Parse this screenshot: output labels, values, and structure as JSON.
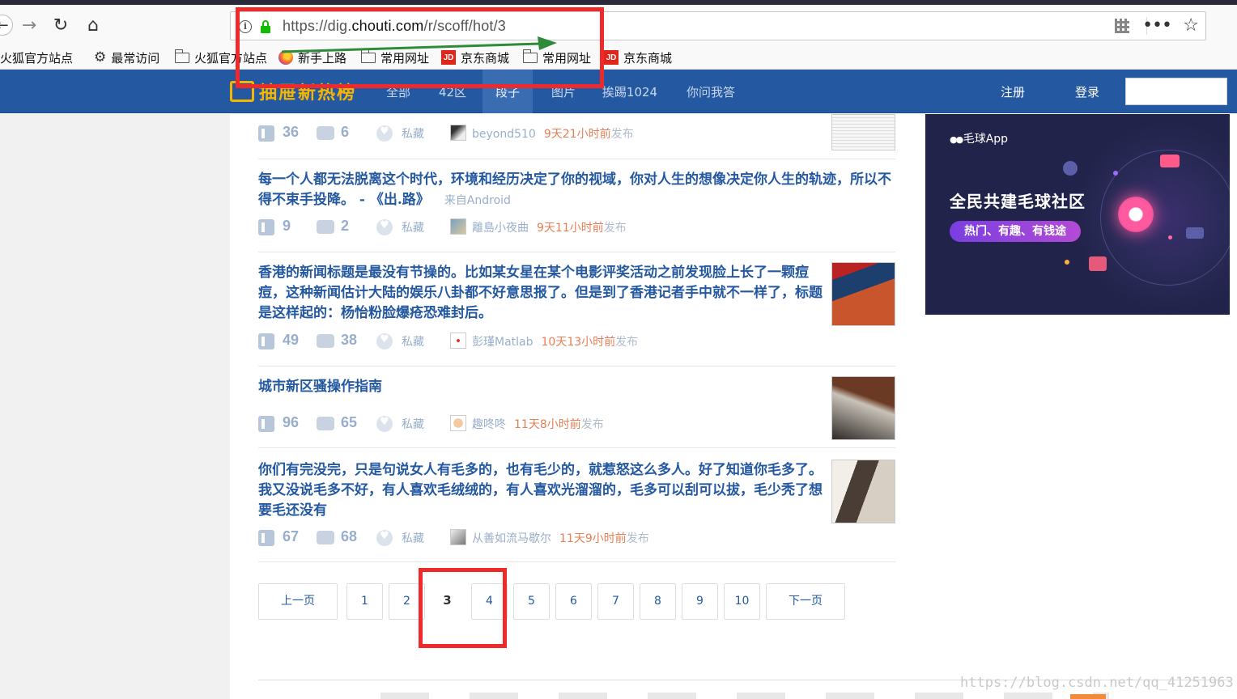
{
  "browser": {
    "url_prefix": "https://dig.",
    "url_domain": "chouti.com",
    "url_path": "/r/scoff/hot/3",
    "bookmarks": [
      "火狐官方站点",
      "最常访问",
      "火狐官方站点",
      "新手上路",
      "常用网址",
      "京东商城",
      "常用网址",
      "京东商城"
    ],
    "jd_badge": "JD"
  },
  "site": {
    "logo_text": "抽屉新热榜",
    "nav": [
      "全部",
      "42区",
      "段子",
      "图片",
      "挨踢1024",
      "你问我答"
    ],
    "active_nav": "段子",
    "register": "注册",
    "login": "登录"
  },
  "items": [
    {
      "title": "",
      "likes": "36",
      "comments": "6",
      "fav": "私藏",
      "user": "beyond510",
      "time": "9天21小时前",
      "pub": "发布"
    },
    {
      "title": "每一个人都无法脱离这个时代，环境和经历决定了你的视域，你对人生的想像决定你人生的轨迹，所以不得不束手投降。 - 《出.路》",
      "source": "来自Android",
      "likes": "9",
      "comments": "2",
      "fav": "私藏",
      "user": "離島小夜曲",
      "time": "9天11小时前",
      "pub": "发布"
    },
    {
      "title": "香港的新闻标题是最没有节操的。比如某女星在某个电影评奖活动之前发现脸上长了一颗痘痘，这种新闻估计大陆的娱乐八卦都不好意思报了。但是到了香港记者手中就不一样了，标题是这样起的：杨怡粉脸爆疮恐难封后。",
      "likes": "49",
      "comments": "38",
      "fav": "私藏",
      "user": "彭瑾Matlab",
      "time": "10天13小时前",
      "pub": "发布"
    },
    {
      "title": "城市新区骚操作指南",
      "likes": "96",
      "comments": "65",
      "fav": "私藏",
      "user": "趣咚咚",
      "time": "11天8小时前",
      "pub": "发布"
    },
    {
      "title": "你们有完没完，只是句说女人有毛多的，也有毛少的，就惹怒这么多人。好了知道你毛多了。我又没说毛多不好，有人喜欢毛绒绒的，有人喜欢光溜溜的，毛多可以刮可以拔，毛少秃了想要毛还没有",
      "likes": "67",
      "comments": "68",
      "fav": "私藏",
      "user": "从善如流马歇尔",
      "time": "11天9小时前",
      "pub": "发布"
    }
  ],
  "pager": {
    "prev": "上一页",
    "pages": [
      "1",
      "2",
      "3",
      "4",
      "5",
      "6",
      "7",
      "8",
      "9",
      "10"
    ],
    "current": "3",
    "next": "下一页"
  },
  "ad": {
    "brand": "毛球App",
    "title": "全民共建毛球社区",
    "pill": "热门、有趣、有钱途"
  },
  "watermark": "https://blog.csdn.net/qq_41251963",
  "colors": {
    "header_blue": "#2459a2",
    "title_blue": "#2459a2",
    "time_orange": "#e77e55",
    "annotation_red": "#ee2a2a",
    "arrow_green": "#2e8b3a"
  }
}
